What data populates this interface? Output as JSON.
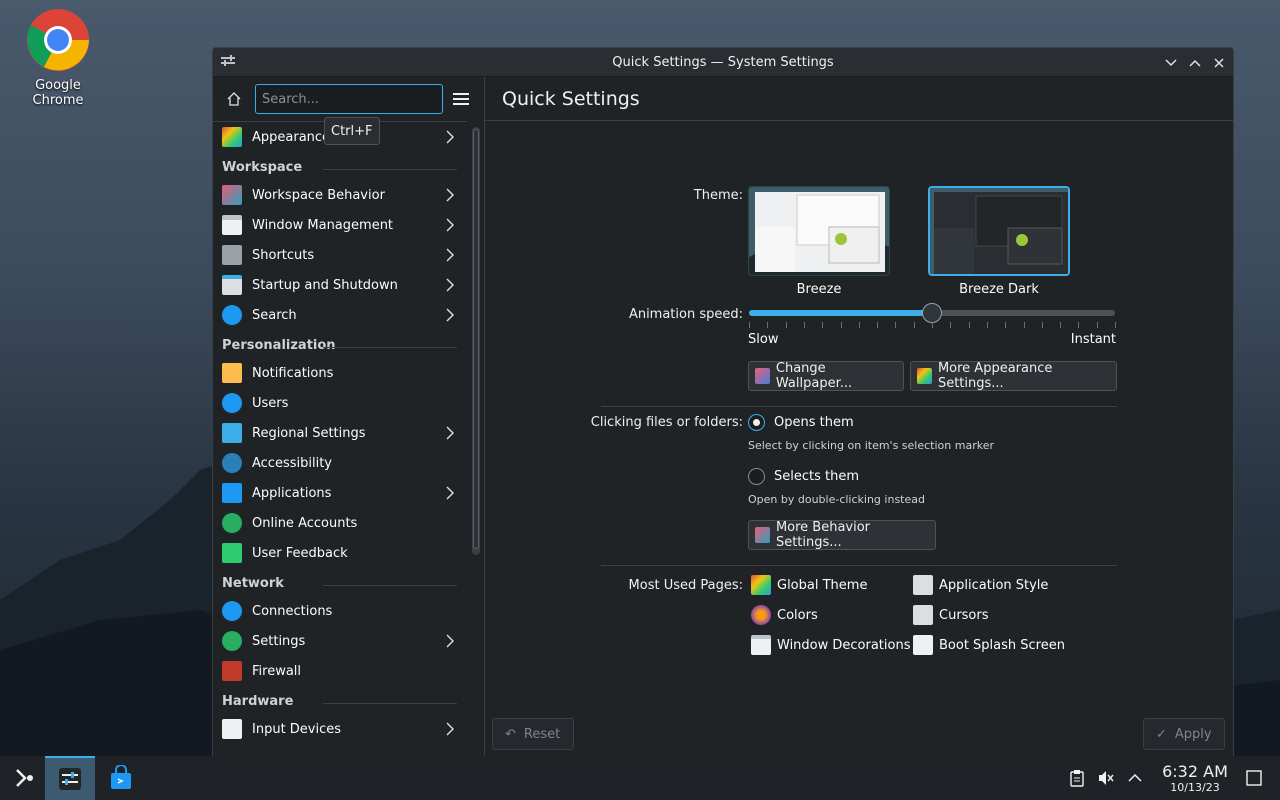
{
  "desktop": {
    "icons": [
      {
        "label": "Google Chrome",
        "icon": "chrome-icon"
      }
    ]
  },
  "window": {
    "title": "Quick Settings — System Settings"
  },
  "sidebar": {
    "search_placeholder": "Search...",
    "tooltip": "Ctrl+F",
    "items": [
      {
        "label": "Appearance",
        "chevron": true
      },
      {
        "category": "Workspace"
      },
      {
        "label": "Workspace Behavior",
        "chevron": true
      },
      {
        "label": "Window Management",
        "chevron": true
      },
      {
        "label": "Shortcuts",
        "chevron": true
      },
      {
        "label": "Startup and Shutdown",
        "chevron": true
      },
      {
        "label": "Search",
        "chevron": true
      },
      {
        "category": "Personalization"
      },
      {
        "label": "Notifications",
        "chevron": false
      },
      {
        "label": "Users",
        "chevron": false
      },
      {
        "label": "Regional Settings",
        "chevron": true
      },
      {
        "label": "Accessibility",
        "chevron": false
      },
      {
        "label": "Applications",
        "chevron": true
      },
      {
        "label": "Online Accounts",
        "chevron": false
      },
      {
        "label": "User Feedback",
        "chevron": false
      },
      {
        "category": "Network"
      },
      {
        "label": "Connections",
        "chevron": false
      },
      {
        "label": "Settings",
        "chevron": true
      },
      {
        "label": "Firewall",
        "chevron": false
      },
      {
        "category": "Hardware"
      },
      {
        "label": "Input Devices",
        "chevron": true
      }
    ]
  },
  "main": {
    "title": "Quick Settings",
    "theme_label": "Theme:",
    "themes": [
      {
        "name": "Breeze",
        "selected": false
      },
      {
        "name": "Breeze Dark",
        "selected": true
      }
    ],
    "animation_label": "Animation speed:",
    "animation_slow": "Slow",
    "animation_instant": "Instant",
    "animation_value_fraction": 0.5,
    "change_wallpaper": "Change Wallpaper...",
    "more_appearance": "More Appearance Settings...",
    "clicking_label": "Clicking files or folders:",
    "opens_them": "Opens them",
    "opens_hint": "Select by clicking on item's selection marker",
    "selects_them": "Selects them",
    "selects_hint": "Open by double-clicking instead",
    "more_behavior": "More Behavior Settings...",
    "most_used_label": "Most Used Pages:",
    "most_used": [
      {
        "label": "Global Theme"
      },
      {
        "label": "Application Style"
      },
      {
        "label": "Colors"
      },
      {
        "label": "Cursors"
      },
      {
        "label": "Window Decorations"
      },
      {
        "label": "Boot Splash Screen"
      }
    ],
    "reset": "Reset",
    "apply": "Apply"
  },
  "taskbar": {
    "time": "6:32 AM",
    "date": "10/13/23"
  },
  "colors": {
    "accent": "#3daee9",
    "window_bg": "#202326"
  }
}
